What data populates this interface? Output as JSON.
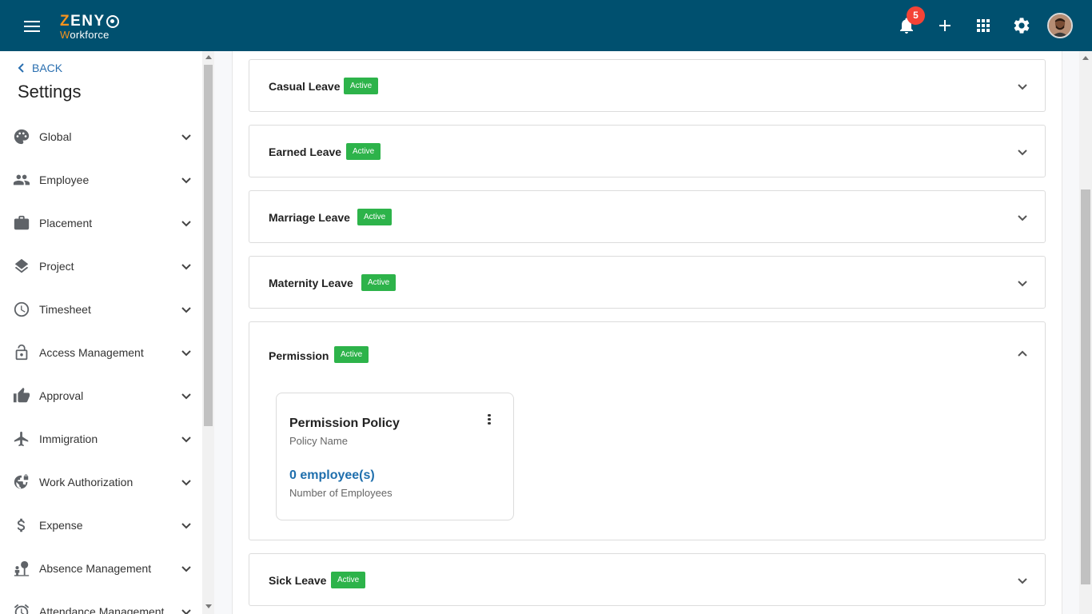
{
  "header": {
    "logo_top_first": "Z",
    "logo_top_rest": "ENY",
    "logo_bottom_first": "W",
    "logo_bottom_rest": "orkforce",
    "notification_count": "5",
    "brand_color": "#00506f",
    "accent_color": "#f7931e",
    "icons": [
      "menu-icon",
      "bell-icon",
      "plus-icon",
      "apps-grid-icon",
      "gear-icon",
      "avatar"
    ]
  },
  "sidebar": {
    "back_label": "BACK",
    "title": "Settings",
    "items": [
      {
        "label": "Global",
        "icon": "palette-icon"
      },
      {
        "label": "Employee",
        "icon": "people-icon"
      },
      {
        "label": "Placement",
        "icon": "briefcase-icon"
      },
      {
        "label": "Project",
        "icon": "layers-icon"
      },
      {
        "label": "Timesheet",
        "icon": "clock-icon"
      },
      {
        "label": "Access Management",
        "icon": "lock-icon"
      },
      {
        "label": "Approval",
        "icon": "thumbs-up-icon"
      },
      {
        "label": "Immigration",
        "icon": "airplane-icon"
      },
      {
        "label": "Work Authorization",
        "icon": "globe-lock-icon"
      },
      {
        "label": "Expense",
        "icon": "dollar-icon"
      },
      {
        "label": "Absence Management",
        "icon": "person-tree-icon"
      },
      {
        "label": "Attendance Management",
        "icon": "alarm-icon"
      }
    ]
  },
  "main": {
    "status_color": "#2db34a",
    "leave_types": [
      {
        "title": "Casual Leave",
        "status": "Active",
        "expanded": false
      },
      {
        "title": "Earned Leave",
        "status": "Active",
        "expanded": false
      },
      {
        "title": "Marriage Leave",
        "status": "Active",
        "expanded": false
      },
      {
        "title": "Maternity Leave",
        "status": "Active",
        "expanded": false
      },
      {
        "title": "Permission",
        "status": "Active",
        "expanded": true
      },
      {
        "title": "Sick Leave",
        "status": "Active",
        "expanded": false
      }
    ],
    "policy_card": {
      "title": "Permission Policy",
      "subtitle": "Policy Name",
      "count": "0 employee(s)",
      "count_label": "Number of Employees"
    }
  }
}
